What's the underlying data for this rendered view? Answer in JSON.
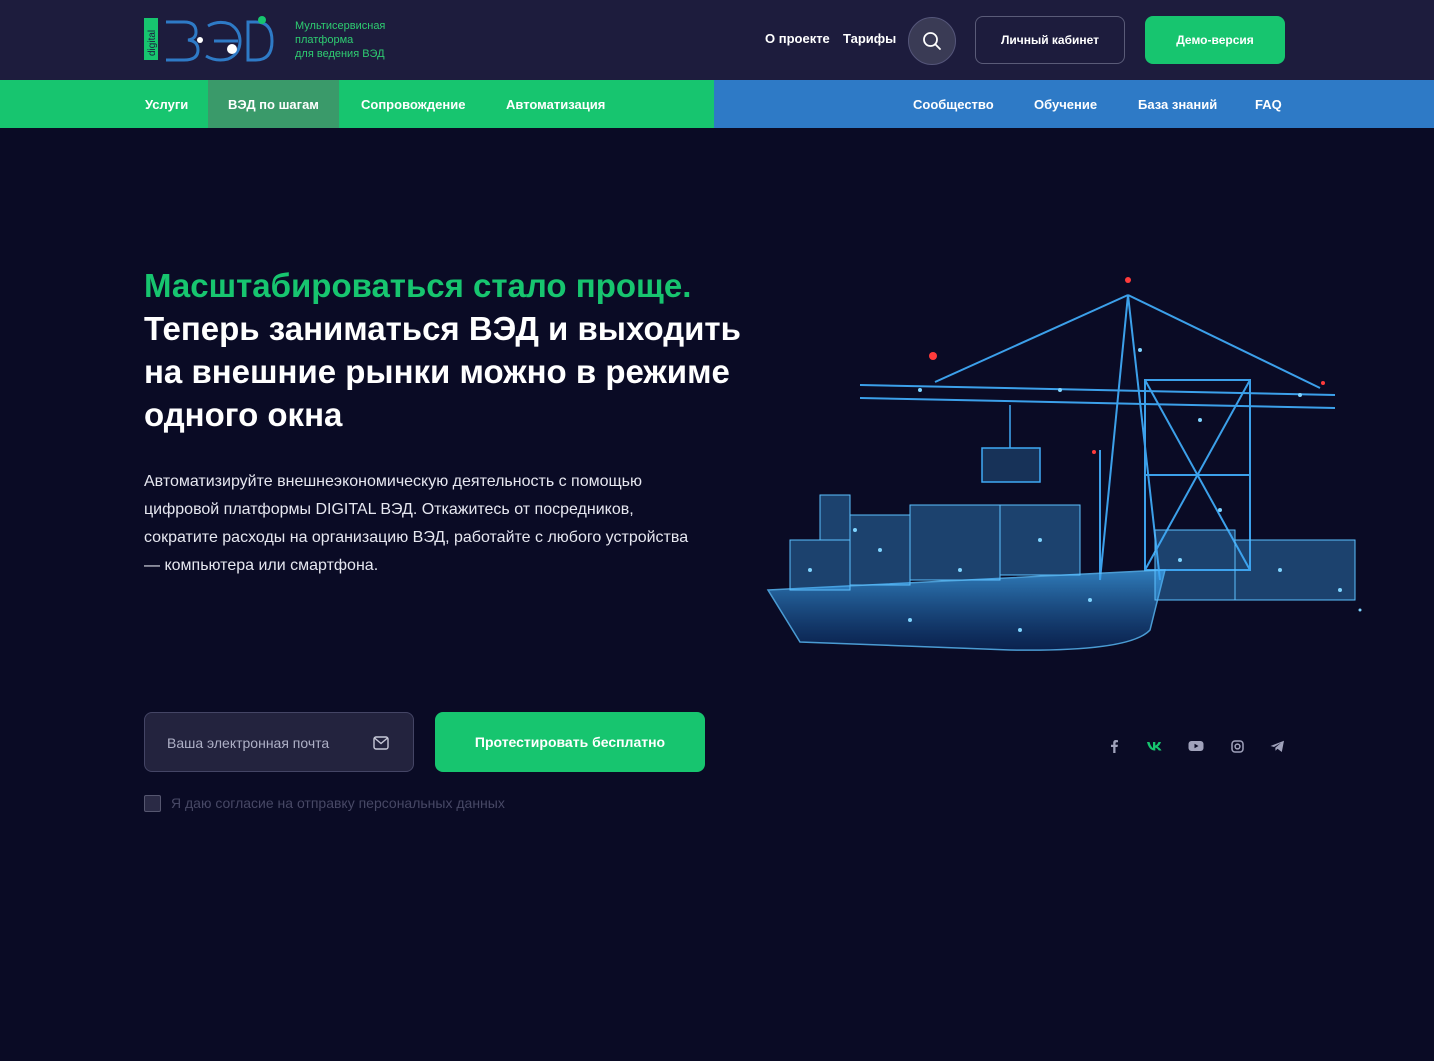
{
  "brand": {
    "logo_text": "ВЭД",
    "logo_vertical": "digital",
    "tagline": [
      "Мультисервисная",
      "платформа",
      "для ведения ВЭД"
    ],
    "accent_color": "#17c56f",
    "blue_color": "#2e7ac6"
  },
  "header": {
    "links": [
      "О проекте",
      "Тарифы"
    ],
    "search_icon": "search-icon",
    "cabinet_label": "Личный кабинет",
    "demo_label": "Демо-версия"
  },
  "nav": {
    "left": [
      {
        "label": "Услуги",
        "active": false
      },
      {
        "label": "ВЭД по шагам",
        "active": true
      },
      {
        "label": "Сопровождение",
        "active": false
      },
      {
        "label": "Автоматизация",
        "active": false
      }
    ],
    "right": [
      {
        "label": "Сообщество"
      },
      {
        "label": "Обучение"
      },
      {
        "label": "База знаний"
      },
      {
        "label": "FAQ"
      }
    ]
  },
  "hero": {
    "title_accent": "Масштабироваться стало проще.",
    "title_main": "Теперь заниматься ВЭД и выходить на внешние рынки можно в режиме одного окна",
    "description": "Автоматизируйте внешнеэкономическую деятельность с помощью цифровой платформы DIGITAL ВЭД. Откажитесь от посредников, сократите расходы на организацию ВЭД, работайте с любого устройства — компьютера или смартфона."
  },
  "form": {
    "email_placeholder": "Ваша электронная почта",
    "email_value": "",
    "cta_label": "Протестировать бесплатно",
    "consent_label": "Я даю согласие на отправку персональных данных",
    "consent_checked": false
  },
  "socials": [
    "facebook-icon",
    "vk-icon",
    "youtube-icon",
    "instagram-icon",
    "telegram-icon"
  ]
}
